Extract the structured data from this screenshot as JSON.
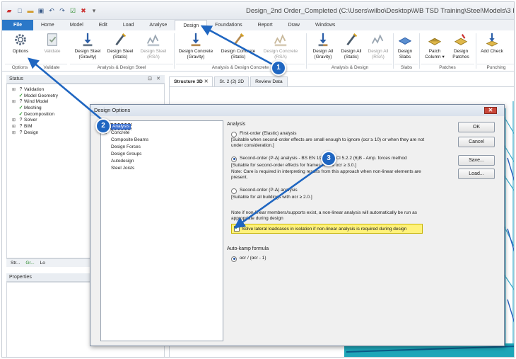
{
  "window": {
    "title": "Design_2nd Order_Completed (C:\\Users\\wilbo\\Desktop\\WB TSD Training\\Steel\\Models\\3 Desi"
  },
  "ribbon_tabs": [
    "File",
    "Home",
    "Model",
    "Edit",
    "Load",
    "Analyse",
    "Design",
    "Foundations",
    "Report",
    "Draw",
    "Windows"
  ],
  "active_tab": "Design",
  "ribbon": {
    "buttons": [
      {
        "label": "Options",
        "icon": "gear-icon"
      },
      {
        "label": "Validate",
        "icon": "clipboard-check-icon"
      },
      {
        "label": "Design Steel (Gravity)",
        "icon": "steel-gravity-icon"
      },
      {
        "label": "Design Steel (Static)",
        "icon": "steel-static-icon"
      },
      {
        "label": "Design Steel (RSA)",
        "icon": "steel-rsa-icon"
      },
      {
        "label": "Design Concrete (Gravity)",
        "icon": "concrete-gravity-icon"
      },
      {
        "label": "Design Concrete (Static)",
        "icon": "concrete-static-icon"
      },
      {
        "label": "Design Concrete (RSA)",
        "icon": "concrete-rsa-icon"
      },
      {
        "label": "Design All (Gravity)",
        "icon": "all-gravity-icon"
      },
      {
        "label": "Design All (Static)",
        "icon": "all-static-icon"
      },
      {
        "label": "Design All (RSA)",
        "icon": "all-rsa-icon"
      },
      {
        "label": "Design Slabs",
        "icon": "slabs-icon"
      },
      {
        "label": "Patch Column ▾",
        "icon": "patch-column-icon"
      },
      {
        "label": "Design Patches",
        "icon": "design-patches-icon"
      },
      {
        "label": "Add Check",
        "icon": "add-check-icon"
      }
    ],
    "groups": [
      "Options",
      "Validate",
      "Analysis & Design Steel",
      "Analysis & Design Concrete",
      "Analysis & Design",
      "Slabs",
      "Patches",
      "Punching"
    ]
  },
  "status_panel": {
    "title": "Status",
    "header_icons": [
      "pin-icon",
      "close-icon"
    ],
    "items": [
      {
        "label": "Validation",
        "state": "pin",
        "expandable": true
      },
      {
        "label": "Model Geometry",
        "state": "check",
        "expandable": false
      },
      {
        "label": "Wind Model",
        "state": "pin",
        "expandable": true
      },
      {
        "label": "Meshing",
        "state": "check",
        "expandable": false
      },
      {
        "label": "Decomposition",
        "state": "check",
        "expandable": false
      },
      {
        "label": "Solver",
        "state": "pin",
        "expandable": true
      },
      {
        "label": "BIM",
        "state": "pin",
        "expandable": true
      },
      {
        "label": "Design",
        "state": "pin",
        "expandable": true
      }
    ],
    "bottom_tabs": [
      "Str...",
      "Gr...",
      "Lo"
    ]
  },
  "properties_panel": {
    "title": "Properties"
  },
  "doc_tabs": [
    "Structure 3D",
    "St. 2 (2) 2D",
    "Review Data"
  ],
  "dialog": {
    "title": "Design Options",
    "tree": [
      "Analysis",
      "Concrete",
      "Composite Beams",
      "Design Forces",
      "Design Groups",
      "Autodesign",
      "Steel Joists"
    ],
    "section_label": "Analysis",
    "options": {
      "first_order": "First-order (Elastic) analysis",
      "first_order_note": "[Suitable when second-order effects are small enough to ignore (αcr ≥ 10) or when they are not under consideration.]",
      "second_order_amp": "Second-order (P-Δ) analysis - BS EN 1993-1-1 Cl 5.2.2 (6)B - Amp. forces method",
      "second_order_amp_note": "[Suitable for second-order effects for frames where αcr ≥ 3.0.]",
      "care_note": "Note: Care is required in interpreting results from this approach when non-linear elements are present.",
      "second_order": "Second-order (P-Δ) analysis",
      "second_order_note": "[Suitable for all buildings with αcr ≥ 2.0.]",
      "nonlinear_note": "Note if non-linear members/supports exist, a non-linear analysis will automatically be run as appropriate during design",
      "solve_lateral": "Solve lateral loadcases in isolation if non-linear analysis is required during design",
      "selected": "second_order_amp",
      "solve_lateral_checked": true
    },
    "auto_k_label": "Auto-kamp formula",
    "auto_k_option": "αcr / (αcr - 1)",
    "buttons": {
      "ok": "OK",
      "cancel": "Cancel",
      "save": "Save...",
      "load": "Load..."
    }
  },
  "callouts": [
    "1",
    "2",
    "3"
  ],
  "colors": {
    "accent": "#1f66c1",
    "file_tab": "#2b78c8",
    "highlight": "#fff27a",
    "close": "#c9473a"
  }
}
